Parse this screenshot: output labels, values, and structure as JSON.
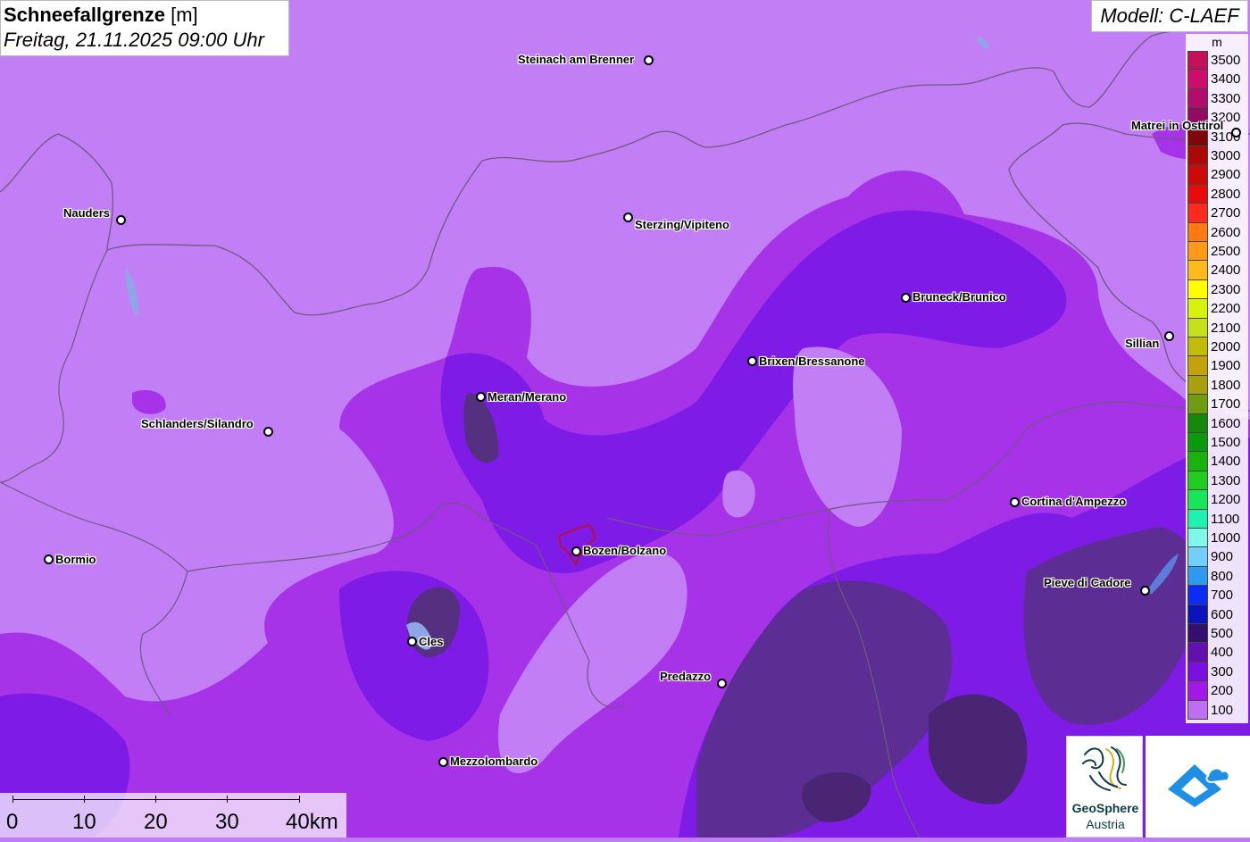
{
  "header": {
    "title": "Schneefallgrenze",
    "unit": "[m]",
    "datetime": "Freitag, 21.11.2025 09:00 Uhr"
  },
  "model": {
    "label": "Modell: C-LAEF"
  },
  "legend": {
    "unit": "m",
    "entries": [
      {
        "label": "3500",
        "color": "#c40f5a"
      },
      {
        "label": "3400",
        "color": "#cc0d6b"
      },
      {
        "label": "3300",
        "color": "#b00d6e"
      },
      {
        "label": "3200",
        "color": "#930a62"
      },
      {
        "label": "3100",
        "color": "#7d0707"
      },
      {
        "label": "3000",
        "color": "#ad0808"
      },
      {
        "label": "2900",
        "color": "#cc0a0a"
      },
      {
        "label": "2800",
        "color": "#e70b0b"
      },
      {
        "label": "2700",
        "color": "#ff2a1f"
      },
      {
        "label": "2600",
        "color": "#ff7a14"
      },
      {
        "label": "2500",
        "color": "#ff9a18"
      },
      {
        "label": "2400",
        "color": "#ffbb1e"
      },
      {
        "label": "2300",
        "color": "#ffff00"
      },
      {
        "label": "2200",
        "color": "#d8f20e"
      },
      {
        "label": "2100",
        "color": "#c4e217"
      },
      {
        "label": "2000",
        "color": "#c1bb0a"
      },
      {
        "label": "1900",
        "color": "#c4a10e"
      },
      {
        "label": "1800",
        "color": "#a9a00d"
      },
      {
        "label": "1700",
        "color": "#6d9d12"
      },
      {
        "label": "1600",
        "color": "#15870a"
      },
      {
        "label": "1500",
        "color": "#0c9a0d"
      },
      {
        "label": "1400",
        "color": "#18b30e"
      },
      {
        "label": "1300",
        "color": "#22cb21"
      },
      {
        "label": "1200",
        "color": "#19e55a"
      },
      {
        "label": "1100",
        "color": "#20f0b0"
      },
      {
        "label": "1000",
        "color": "#80f7ec"
      },
      {
        "label": "900",
        "color": "#72cff9"
      },
      {
        "label": "800",
        "color": "#2f9bf0"
      },
      {
        "label": "700",
        "color": "#0c2cf3"
      },
      {
        "label": "600",
        "color": "#0a14b9"
      },
      {
        "label": "500",
        "color": "#331070"
      },
      {
        "label": "400",
        "color": "#6310b0"
      },
      {
        "label": "300",
        "color": "#7a10e0"
      },
      {
        "label": "200",
        "color": "#a219e6"
      },
      {
        "label": "100",
        "color": "#be6ef0"
      }
    ]
  },
  "cities": [
    {
      "name": "Steinach am Brenner"
    },
    {
      "name": "Matrei in Osttirol"
    },
    {
      "name": "Nauders"
    },
    {
      "name": "Sterzing/Vipiteno"
    },
    {
      "name": "Bruneck/Brunico"
    },
    {
      "name": "Sillian"
    },
    {
      "name": "Brixen/Bressanone"
    },
    {
      "name": "Meran/Merano"
    },
    {
      "name": "Schlanders/Silandro"
    },
    {
      "name": "Cortina d'Ampezzo"
    },
    {
      "name": "Bormio"
    },
    {
      "name": "Bozen/Bolzano"
    },
    {
      "name": "Pieve di Cadore"
    },
    {
      "name": "Cles"
    },
    {
      "name": "Predazzo"
    },
    {
      "name": "Mezzolombardo"
    }
  ],
  "scalebar": {
    "labels": [
      "0",
      "10",
      "20",
      "30",
      "40km"
    ]
  },
  "logos": {
    "geosphere_line1": "GeoSphere",
    "geosphere_line2": "Austria",
    "other_icon": "cloud-diamond-logo-icon"
  }
}
